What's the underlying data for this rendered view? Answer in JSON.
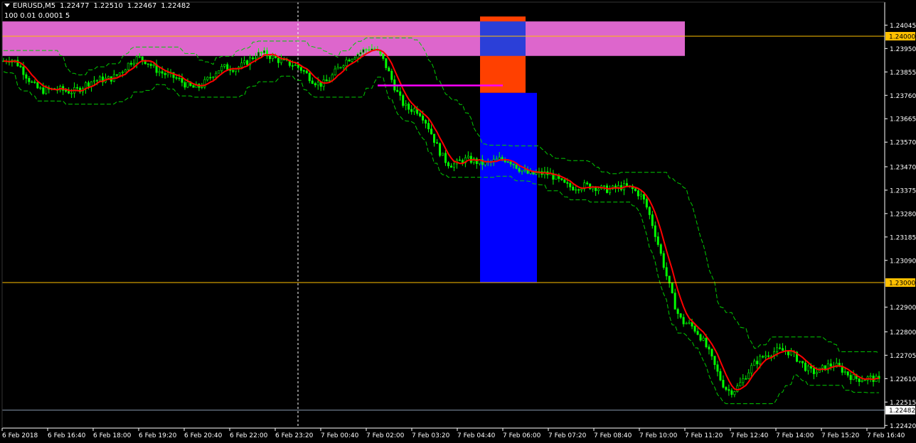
{
  "header": {
    "symbol": "EURUSD,M5",
    "open": "1.22477",
    "high": "1.22510",
    "low": "1.22467",
    "close": "1.22482",
    "indicator_params": "100 0.01 0.0001 5"
  },
  "colors": {
    "background": "#000000",
    "axis": "#ffffff",
    "candles": "#00ff00",
    "moving_average": "#ff0000",
    "envelope": "#00cc00",
    "level_line": "#ffc000",
    "price_line": "#8a9bb0",
    "zone_pink": "#dd66cc",
    "zone_orange": "#ff4000",
    "zone_blue_small": "#2b3fd8",
    "zone_blue_large": "#0000ff",
    "magenta_line": "#ff00ff"
  },
  "chart_data": {
    "type": "candlestick",
    "symbol": "EURUSD",
    "timeframe": "M5",
    "y_ticks": [
      "1.24045",
      "1.23950",
      "1.23855",
      "1.23760",
      "1.23665",
      "1.23570",
      "1.23470",
      "1.23375",
      "1.23280",
      "1.23185",
      "1.23090",
      "1.22900",
      "1.22800",
      "1.22705",
      "1.22610",
      "1.22515",
      "1.22420"
    ],
    "y_range": [
      1.2241,
      1.2414
    ],
    "x_ticks": [
      "6 Feb 2018",
      "6 Feb 16:40",
      "6 Feb 18:00",
      "6 Feb 19:20",
      "6 Feb 20:40",
      "6 Feb 22:00",
      "6 Feb 23:20",
      "7 Feb 00:40",
      "7 Feb 02:00",
      "7 Feb 03:20",
      "7 Feb 04:40",
      "7 Feb 06:00",
      "7 Feb 07:20",
      "7 Feb 08:40",
      "7 Feb 10:00",
      "7 Feb 11:20",
      "7 Feb 12:40",
      "7 Feb 14:00",
      "7 Feb 15:20",
      "7 Feb 16:40"
    ],
    "price_path": [
      {
        "time": "6 Feb 2018",
        "price": 1.239
      },
      {
        "time": "6 Feb 16:40",
        "price": 1.2376
      },
      {
        "time": "6 Feb 18:00",
        "price": 1.2383
      },
      {
        "time": "6 Feb 19:20",
        "price": 1.2388
      },
      {
        "time": "6 Feb 20:40",
        "price": 1.2381
      },
      {
        "time": "6 Feb 22:00",
        "price": 1.2388
      },
      {
        "time": "6 Feb 23:20",
        "price": 1.239
      },
      {
        "time": "7 Feb 00:40",
        "price": 1.2384
      },
      {
        "time": "7 Feb 02:00",
        "price": 1.2394
      },
      {
        "time": "7 Feb 03:20",
        "price": 1.2371
      },
      {
        "time": "7 Feb 04:40",
        "price": 1.2349
      },
      {
        "time": "7 Feb 06:00",
        "price": 1.2347
      },
      {
        "time": "7 Feb 07:20",
        "price": 1.2345
      },
      {
        "time": "7 Feb 08:40",
        "price": 1.2337
      },
      {
        "time": "7 Feb 10:00",
        "price": 1.2336
      },
      {
        "time": "7 Feb 11:20",
        "price": 1.2286
      },
      {
        "time": "7 Feb 12:40",
        "price": 1.2255
      },
      {
        "time": "7 Feb 14:00",
        "price": 1.2275
      },
      {
        "time": "7 Feb 15:20",
        "price": 1.2264
      },
      {
        "time": "7 Feb 16:40",
        "price": 1.226
      }
    ],
    "levels": [
      {
        "price": 1.24,
        "label": "1.24000",
        "color": "#ffc000"
      },
      {
        "price": 1.23,
        "label": "1.23000",
        "color": "#ffc000"
      },
      {
        "price": 1.22482,
        "label": "1.22482",
        "color": "#8a9bb0"
      }
    ],
    "zones": [
      {
        "color": "#dd66cc",
        "time_start": "6 Feb 2018",
        "time_end": "7 Feb 11:20",
        "price_top": 1.2406,
        "price_bottom": 1.2392
      },
      {
        "color": "#ff4000",
        "time_start": "7 Feb 05:20",
        "time_end": "7 Feb 06:40",
        "price_top": 1.2408,
        "price_bottom": 1.2377
      },
      {
        "color": "#2b3fd8",
        "time_start": "7 Feb 05:20",
        "time_end": "7 Feb 06:40",
        "price_top": 1.2406,
        "price_bottom": 1.2392
      },
      {
        "color": "#0000ff",
        "time_start": "7 Feb 05:20",
        "time_end": "7 Feb 07:00",
        "price_top": 1.2377,
        "price_bottom": 1.23
      }
    ],
    "segments": [
      {
        "color": "#ff00ff",
        "time_start": "7 Feb 02:20",
        "time_end": "7 Feb 06:00",
        "price": 1.238
      }
    ],
    "vertical_marker": {
      "time": "6 Feb 23:20",
      "style": "dashed"
    },
    "grid": false
  }
}
